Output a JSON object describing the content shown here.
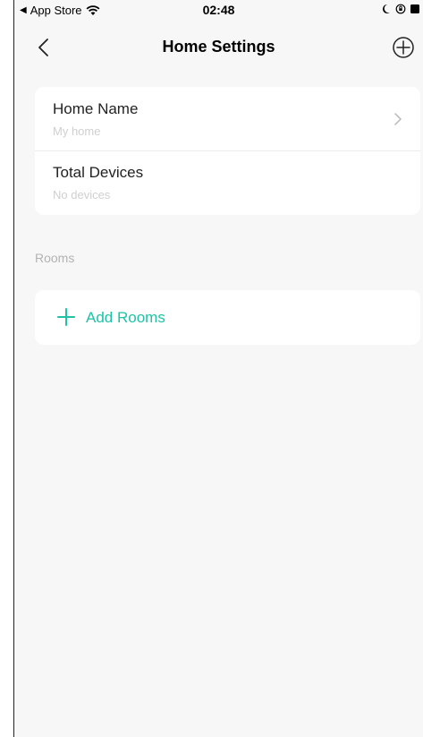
{
  "status_bar": {
    "back_app": "App Store",
    "time": "02:48"
  },
  "nav": {
    "title": "Home Settings"
  },
  "home_info": {
    "items": [
      {
        "title": "Home Name",
        "subtitle": "My home"
      },
      {
        "title": "Total Devices",
        "subtitle": "No devices"
      }
    ]
  },
  "rooms": {
    "section_label": "Rooms",
    "add_label": "Add Rooms"
  },
  "colors": {
    "accent": "#1ec3a6",
    "background": "#f7f7f7",
    "card": "#ffffff",
    "muted_text": "#cfcfcf"
  }
}
